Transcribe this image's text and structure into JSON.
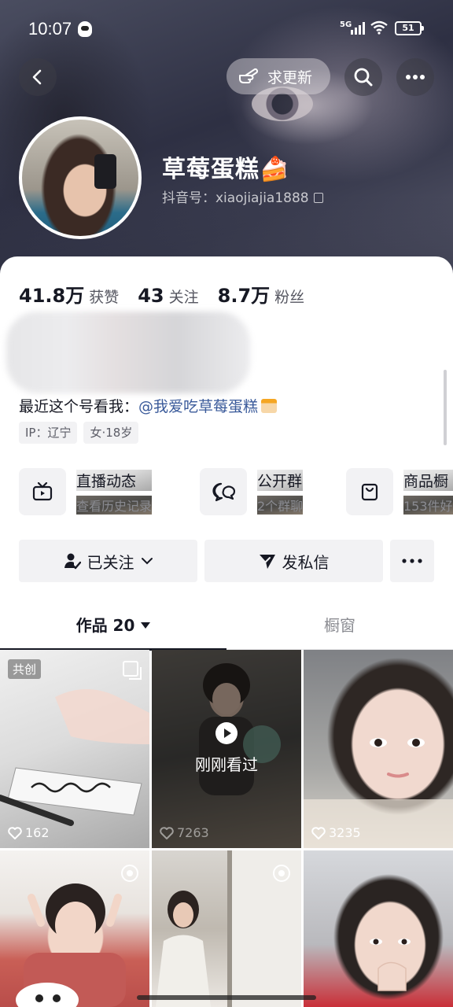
{
  "status_bar": {
    "time": "10:07",
    "network": "5G",
    "battery": "51"
  },
  "header": {
    "request_update_label": "求更新",
    "nickname": "草莓蛋糕🍰",
    "douyin_id": "抖音号：xiaojiajia1888"
  },
  "stats": [
    {
      "value": "41.8万",
      "label": "获赞"
    },
    {
      "value": "43",
      "label": "关注"
    },
    {
      "value": "8.7万",
      "label": "粉丝"
    }
  ],
  "bio": {
    "prefix": "最近这个号看我：",
    "mention": "@我爱吃草莓蛋糕"
  },
  "tags": [
    "IP：辽宁",
    "女·18岁"
  ],
  "services": [
    {
      "title": "直播动态",
      "subtitle": "查看历史记录",
      "icon": "tv-icon"
    },
    {
      "title": "公开群",
      "subtitle": "2个群聊",
      "icon": "chat-group-icon"
    },
    {
      "title": "商品橱",
      "subtitle": "153件好",
      "icon": "shop-bag-icon"
    }
  ],
  "actions": {
    "followed_label": "已关注",
    "message_label": "发私信"
  },
  "tabs": {
    "works_label": "作品 20",
    "showcase_label": "橱窗"
  },
  "videos": [
    {
      "likes": "162",
      "badge": "共创"
    },
    {
      "likes": "7263",
      "overlay": "刚刚看过"
    },
    {
      "likes": "3235"
    },
    {},
    {},
    {}
  ],
  "colors": {
    "text_primary": "#161823",
    "mention": "#3a5a9a",
    "chip_bg": "#f2f2f4"
  }
}
